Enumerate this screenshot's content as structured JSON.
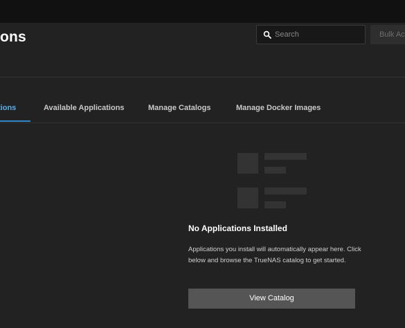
{
  "header": {
    "title": "ons",
    "search": {
      "placeholder": "Search",
      "value": ""
    },
    "bulk_actions_label": "Bulk Ac"
  },
  "tabs": [
    {
      "label": "tions",
      "active": true
    },
    {
      "label": "Available Applications",
      "active": false
    },
    {
      "label": "Manage Catalogs",
      "active": false
    },
    {
      "label": "Manage Docker Images",
      "active": false
    }
  ],
  "empty_state": {
    "title": "No Applications Installed",
    "description": "Applications you install will automatically appear here. Click below and browse the TrueNAS catalog to get started.",
    "button_label": "View Catalog",
    "illustration_icon": "list-placeholder-icon"
  },
  "colors": {
    "background": "#222222",
    "topbar": "#111111",
    "accent": "#2f86c9",
    "active_tab_text": "#5aaee8",
    "button": "#555555"
  }
}
